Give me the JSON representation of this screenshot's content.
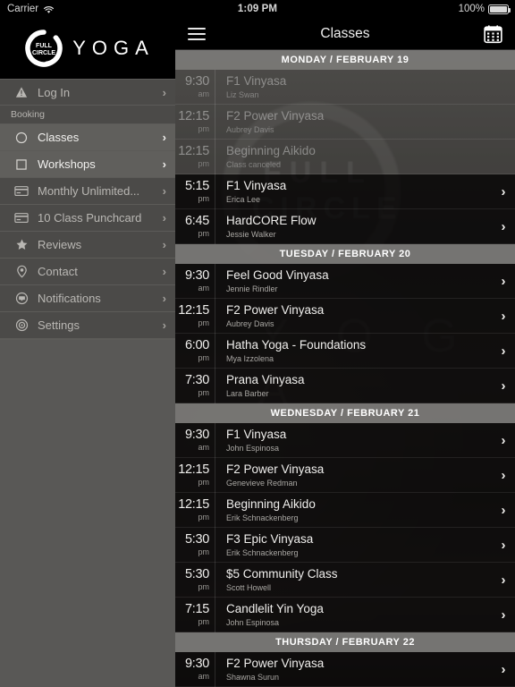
{
  "status_bar": {
    "carrier": "Carrier",
    "wifi_icon": "wifi-icon",
    "time": "1:09 PM",
    "battery_percent": "100%",
    "battery_icon": "battery-full-icon"
  },
  "drawer": {
    "brand": {
      "logo_mark": "full-circle-logo-icon",
      "logo_line1": "FULL",
      "logo_line2": "CIRCLE",
      "wordmark": "YOGA"
    },
    "items": [
      {
        "label": "Log In",
        "icon": "warning-triangle-icon",
        "type": "item",
        "active": false,
        "chevron": "›"
      },
      {
        "label": "Booking",
        "icon": "",
        "type": "section",
        "active": false,
        "chevron": ""
      },
      {
        "label": "Classes",
        "icon": "circle-icon",
        "type": "item",
        "active": true,
        "chevron": "›"
      },
      {
        "label": "Workshops",
        "icon": "square-icon",
        "type": "item",
        "active": true,
        "chevron": "›"
      },
      {
        "label": "Monthly Unlimited...",
        "icon": "credit-card-icon",
        "type": "item",
        "active": false,
        "chevron": "›"
      },
      {
        "label": "10 Class Punchcard",
        "icon": "credit-card-icon",
        "type": "item",
        "active": false,
        "chevron": "›"
      },
      {
        "label": "Reviews",
        "icon": "star-icon",
        "type": "item",
        "active": false,
        "chevron": "›"
      },
      {
        "label": "Contact",
        "icon": "map-pin-icon",
        "type": "item",
        "active": false,
        "chevron": "›"
      },
      {
        "label": "Notifications",
        "icon": "chat-bubble-icon",
        "type": "item",
        "active": false,
        "chevron": "›"
      },
      {
        "label": "Settings",
        "icon": "gear-icon",
        "type": "item",
        "active": false,
        "chevron": "›"
      }
    ]
  },
  "navbar": {
    "menu_icon": "hamburger-menu-icon",
    "title": "Classes",
    "calendar_icon": "calendar-icon"
  },
  "schedule": {
    "days": [
      {
        "header": "MONDAY / FEBRUARY 19",
        "classes": [
          {
            "time": "9:30",
            "ampm": "am",
            "title": "F1 Vinyasa",
            "instructor": "Liz Swan",
            "dimmed": true,
            "chevron": ""
          },
          {
            "time": "12:15",
            "ampm": "pm",
            "title": "F2 Power Vinyasa",
            "instructor": "Aubrey Davis",
            "dimmed": true,
            "chevron": ""
          },
          {
            "time": "12:15",
            "ampm": "pm",
            "title": "Beginning Aikido",
            "instructor": "Class canceled",
            "dimmed": true,
            "chevron": ""
          },
          {
            "time": "5:15",
            "ampm": "pm",
            "title": "F1 Vinyasa",
            "instructor": "Erica Lee",
            "dimmed": false,
            "chevron": "›"
          },
          {
            "time": "6:45",
            "ampm": "pm",
            "title": "HardCORE Flow",
            "instructor": "Jessie Walker",
            "dimmed": false,
            "chevron": "›"
          }
        ]
      },
      {
        "header": "TUESDAY / FEBRUARY 20",
        "classes": [
          {
            "time": "9:30",
            "ampm": "am",
            "title": "Feel Good Vinyasa",
            "instructor": "Jennie Rindler",
            "dimmed": false,
            "chevron": "›"
          },
          {
            "time": "12:15",
            "ampm": "pm",
            "title": "F2 Power Vinyasa",
            "instructor": "Aubrey Davis",
            "dimmed": false,
            "chevron": "›"
          },
          {
            "time": "6:00",
            "ampm": "pm",
            "title": "Hatha Yoga - Foundations",
            "instructor": "Mya Izzolena",
            "dimmed": false,
            "chevron": "›"
          },
          {
            "time": "7:30",
            "ampm": "pm",
            "title": "Prana Vinyasa",
            "instructor": "Lara Barber",
            "dimmed": false,
            "chevron": "›"
          }
        ]
      },
      {
        "header": "WEDNESDAY / FEBRUARY 21",
        "classes": [
          {
            "time": "9:30",
            "ampm": "am",
            "title": "F1 Vinyasa",
            "instructor": "John Espinosa",
            "dimmed": false,
            "chevron": "›"
          },
          {
            "time": "12:15",
            "ampm": "pm",
            "title": "F2 Power Vinyasa",
            "instructor": "Genevieve Redman",
            "dimmed": false,
            "chevron": "›"
          },
          {
            "time": "12:15",
            "ampm": "pm",
            "title": "Beginning Aikido",
            "instructor": "Erik Schnackenberg",
            "dimmed": false,
            "chevron": "›"
          },
          {
            "time": "5:30",
            "ampm": "pm",
            "title": "F3 Epic Vinyasa",
            "instructor": "Erik Schnackenberg",
            "dimmed": false,
            "chevron": "›"
          },
          {
            "time": "5:30",
            "ampm": "pm",
            "title": "$5 Community Class",
            "instructor": "Scott Howell",
            "dimmed": false,
            "chevron": "›"
          },
          {
            "time": "7:15",
            "ampm": "pm",
            "title": "Candlelit Yin Yoga",
            "instructor": "John Espinosa",
            "dimmed": false,
            "chevron": "›"
          }
        ]
      },
      {
        "header": "THURSDAY / FEBRUARY 22",
        "classes": [
          {
            "time": "9:30",
            "ampm": "am",
            "title": "F2 Power Vinyasa",
            "instructor": "Shawna Surun",
            "dimmed": false,
            "chevron": "›"
          }
        ]
      }
    ]
  },
  "watermark": {
    "full": "FULL",
    "circle": "CIRCLE",
    "yoga": "Y O G A"
  },
  "colors": {
    "drawer_bg": "#595856",
    "menu_bg": "#4b4a48",
    "menu_active": "#605f5c",
    "day_header": "#7c7b78",
    "row_bg": "#0a0909",
    "text_primary": "#f0efed",
    "text_secondary": "#a9a7a3"
  }
}
